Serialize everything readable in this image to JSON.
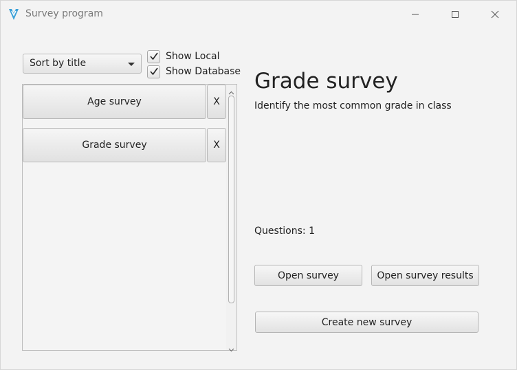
{
  "window": {
    "title": "Survey program",
    "icon": "app-logo-icon",
    "controls": [
      "minimize-icon",
      "maximize-icon",
      "close-icon"
    ]
  },
  "sidebar": {
    "sort": {
      "selected": "Sort by title"
    },
    "filters": [
      {
        "label": "Show Local",
        "checked": true
      },
      {
        "label": "Show Database",
        "checked": true
      }
    ],
    "surveys": [
      {
        "title": "Age survey",
        "delete_label": "X"
      },
      {
        "title": "Grade survey",
        "delete_label": "X"
      }
    ]
  },
  "detail": {
    "title": "Grade survey",
    "description": "Identify the most common grade in class",
    "questions_label": "Questions: 1",
    "open_label": "Open survey",
    "results_label": "Open survey results",
    "create_label": "Create new survey"
  },
  "colors": {
    "background": "#f3f3f3",
    "icon_accent": "#3aa0d8"
  }
}
